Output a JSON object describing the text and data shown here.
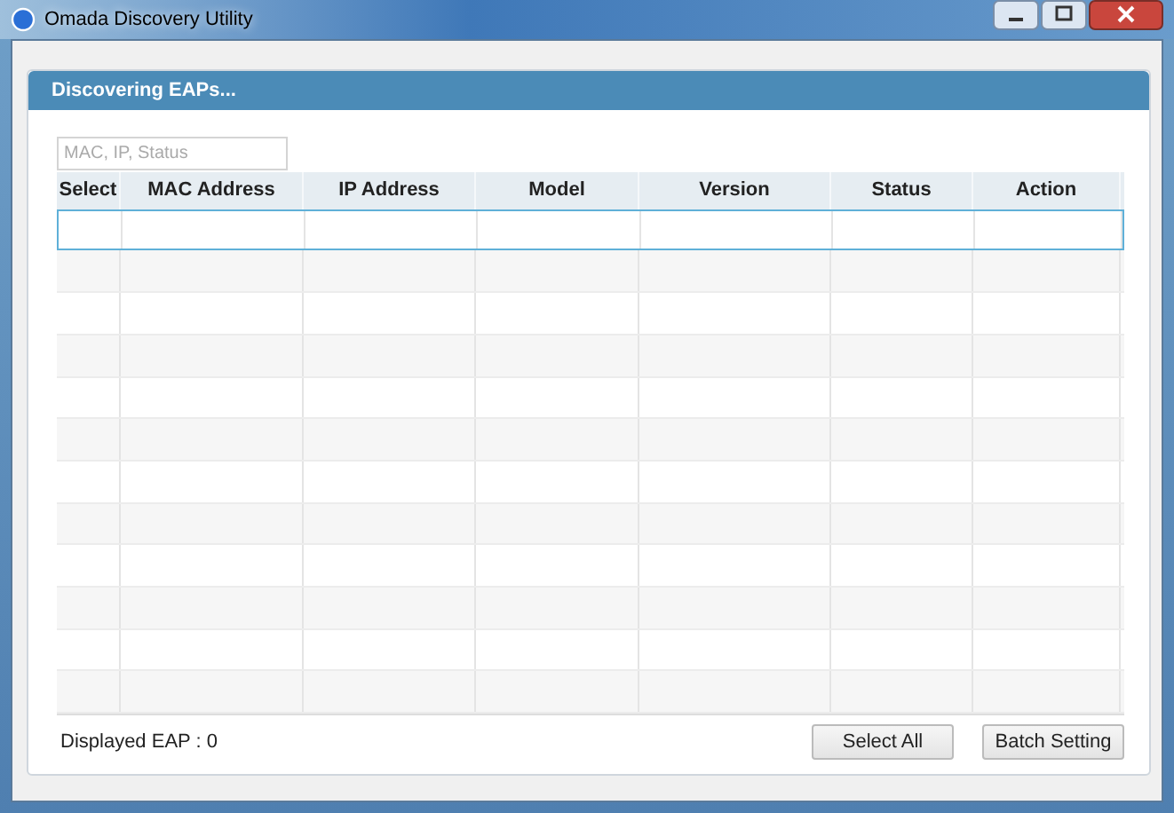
{
  "window": {
    "title": "Omada Discovery Utility"
  },
  "panel": {
    "title": "Discovering EAPs..."
  },
  "search": {
    "placeholder": "MAC, IP, Status"
  },
  "table": {
    "columns": [
      "Select",
      "MAC Address",
      "IP Address",
      "Model",
      "Version",
      "Status",
      "Action"
    ],
    "rows": [
      {
        "selected": true
      },
      {
        "selected": false
      },
      {
        "selected": false
      },
      {
        "selected": false
      },
      {
        "selected": false
      },
      {
        "selected": false
      },
      {
        "selected": false
      },
      {
        "selected": false
      },
      {
        "selected": false
      },
      {
        "selected": false
      },
      {
        "selected": false
      },
      {
        "selected": false
      }
    ]
  },
  "footer": {
    "count_label": "Displayed EAP : 0"
  },
  "buttons": [
    "Select All",
    "Batch Setting"
  ]
}
